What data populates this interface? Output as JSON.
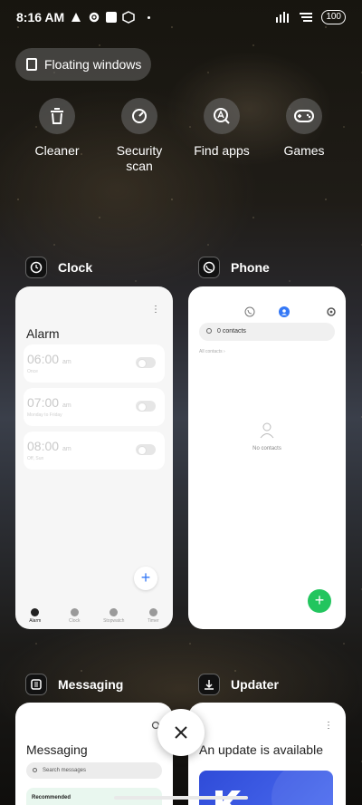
{
  "status_bar": {
    "time": "8:16 AM",
    "battery": "100"
  },
  "floating_windows": {
    "label": "Floating windows"
  },
  "quick_actions": [
    {
      "label": "Cleaner",
      "icon": "trash-icon"
    },
    {
      "label": "Security scan",
      "icon": "security-scan-icon"
    },
    {
      "label": "Find apps",
      "icon": "find-apps-icon"
    },
    {
      "label": "Games",
      "icon": "gamepad-icon"
    }
  ],
  "apps": {
    "clock": {
      "name": "Clock",
      "title": "Alarm",
      "alarms": [
        {
          "time": "06:00",
          "ampm": "am",
          "sub": "Once"
        },
        {
          "time": "07:00",
          "ampm": "am",
          "sub": "Monday to Friday"
        },
        {
          "time": "08:00",
          "ampm": "am",
          "sub": "Off, Sun"
        }
      ],
      "tabs": [
        "Alarm",
        "Clock",
        "Stopwatch",
        "Timer"
      ],
      "active_tab": "Alarm"
    },
    "phone": {
      "name": "Phone",
      "search_placeholder": "0 contacts",
      "all_contacts": "All contacts",
      "empty_text": "No contacts"
    },
    "messaging": {
      "name": "Messaging",
      "title": "Messaging",
      "search_placeholder": "Search messages",
      "recommended": "Recommended"
    },
    "updater": {
      "name": "Updater",
      "title": "An update is available"
    }
  },
  "colors": {
    "fab_green": "#22c55e",
    "accent_blue": "#3478f6",
    "updater_blue": "#2f4bd8"
  }
}
